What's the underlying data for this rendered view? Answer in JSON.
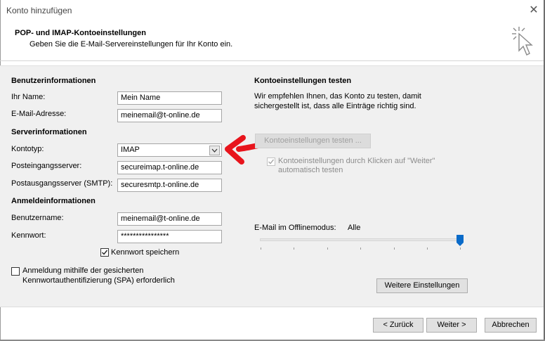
{
  "window": {
    "title": "Konto hinzufügen"
  },
  "header": {
    "title": "POP- und IMAP-Kontoeinstellungen",
    "subtitle": "Geben Sie die E-Mail-Servereinstellungen für Ihr Konto ein."
  },
  "user_info": {
    "heading": "Benutzerinformationen",
    "name_label": "Ihr Name:",
    "name_value": "Mein Name",
    "email_label": "E-Mail-Adresse:",
    "email_value": "meinemail@t-online.de"
  },
  "server_info": {
    "heading": "Serverinformationen",
    "account_type_label": "Kontotyp:",
    "account_type_value": "IMAP",
    "incoming_label": "Posteingangsserver:",
    "incoming_value": "secureimap.t-online.de",
    "outgoing_label": "Postausgangsserver (SMTP):",
    "outgoing_value": "securesmtp.t-online.de"
  },
  "login_info": {
    "heading": "Anmeldeinformationen",
    "username_label": "Benutzername:",
    "username_value": "meinemail@t-online.de",
    "password_label": "Kennwort:",
    "password_value": "****************",
    "remember_label": "Kennwort speichern",
    "remember_checked": true,
    "spa_label_line1": "Anmeldung mithilfe der gesicherten",
    "spa_label_line2": "Kennwortauthentifizierung (SPA) erforderlich",
    "spa_checked": false
  },
  "test": {
    "heading": "Kontoeinstellungen testen",
    "desc_line1": "Wir empfehlen Ihnen, das Konto zu testen, damit",
    "desc_line2": "sichergestellt ist, dass alle Einträge richtig sind.",
    "test_button": "Kontoeinstellungen testen ...",
    "auto_test_line1": "Kontoeinstellungen durch Klicken auf \"Weiter\"",
    "auto_test_line2": "automatisch testen",
    "auto_test_checked": true
  },
  "offline": {
    "label": "E-Mail im Offlinemodus:",
    "value": "Alle",
    "slider_level": 1.0
  },
  "buttons": {
    "more_settings": "Weitere Einstellungen",
    "back": "< Zurück",
    "next": "Weiter >",
    "cancel": "Abbrechen"
  },
  "colors": {
    "annotation_arrow": "#e8141c",
    "slider_thumb": "#0a6bc9"
  }
}
